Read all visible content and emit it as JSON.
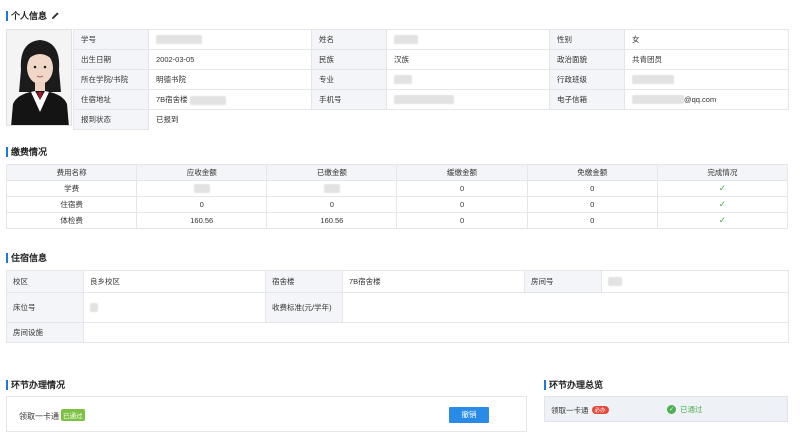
{
  "personal": {
    "title": "个人信息",
    "labels": {
      "student_id": "学号",
      "name": "姓名",
      "gender": "性别",
      "birth": "出生日期",
      "ethnicity": "民族",
      "politics": "政治面貌",
      "college": "所在学院/书院",
      "major": "专业",
      "class": "行政班级",
      "address": "住宿地址",
      "phone": "手机号",
      "email": "电子信箱",
      "status": "报到状态"
    },
    "values": {
      "gender": "女",
      "birth": "2002-03-05",
      "ethnicity": "汉族",
      "politics": "共青团员",
      "college": "明德书院",
      "address": "7B宿舍楼",
      "email": "@qq.com",
      "status": "已报到"
    }
  },
  "fees": {
    "title": "缴费情况",
    "headers": [
      "费用名称",
      "应收金额",
      "已缴金额",
      "缓缴金额",
      "免缴金额",
      "完成情况"
    ],
    "rows": [
      {
        "name": "学费",
        "due": "",
        "paid": "",
        "deferred": "0",
        "waived": "0",
        "done": "✓"
      },
      {
        "name": "住宿费",
        "due": "0",
        "paid": "0",
        "deferred": "0",
        "waived": "0",
        "done": "✓"
      },
      {
        "name": "体检费",
        "due": "160.56",
        "paid": "160.56",
        "deferred": "0",
        "waived": "0",
        "done": "✓"
      }
    ]
  },
  "dorm": {
    "title": "住宿信息",
    "labels": {
      "campus": "校区",
      "building": "宿舍楼",
      "room": "房间号",
      "bed": "床位号",
      "fee_std": "收费标准(元/学年)",
      "facilities": "房间设施"
    },
    "values": {
      "campus": "良乡校区",
      "building": "7B宿舍楼"
    }
  },
  "process": {
    "title": "环节办理情况",
    "item": "领取一卡通",
    "item_tag": "已通过",
    "cancel_label": "撤销"
  },
  "overview": {
    "title": "环节办理总览",
    "item": "领取一卡通",
    "required_tag": "必办",
    "status": "已通过"
  },
  "colors": {
    "accent": "#1e7ad8",
    "success": "#4caf50",
    "button": "#2a8be6",
    "danger": "#e14a3b"
  }
}
